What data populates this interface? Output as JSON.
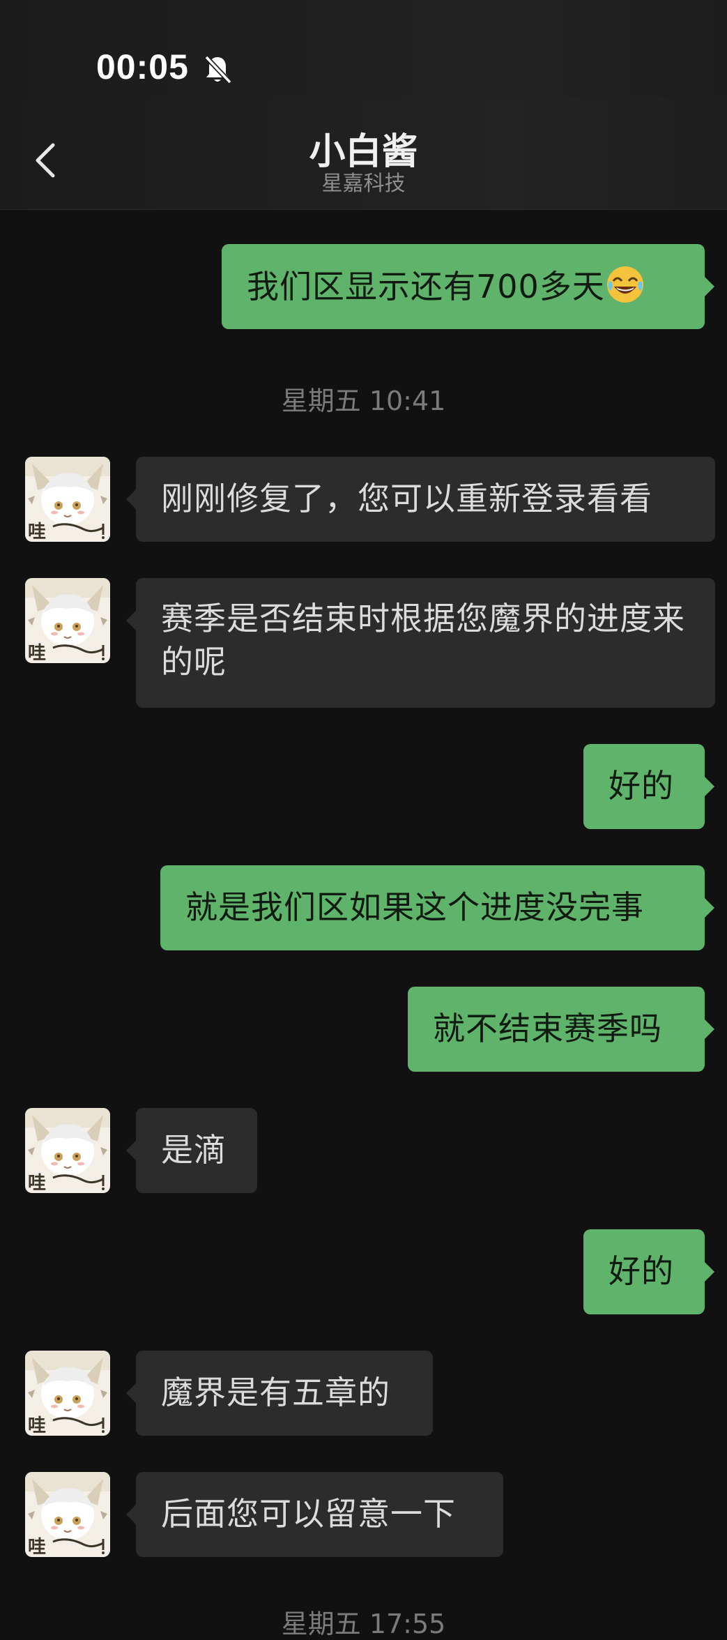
{
  "status_bar": {
    "time": "00:05",
    "mute_icon": "bell-slash-icon"
  },
  "header": {
    "back_icon": "chevron-left-icon",
    "title": "小白酱",
    "subtitle": "星嘉科技"
  },
  "messages": [
    {
      "side": "out",
      "text": "我们区显示还有700多天",
      "emoji": "tears-of-joy-emoji"
    },
    {
      "type": "timestamp",
      "text": "星期五 10:41"
    },
    {
      "side": "in",
      "text": "刚刚修复了，您可以重新登录看看"
    },
    {
      "side": "in",
      "text": "赛季是否结束时根据您魔界的进度来的呢"
    },
    {
      "side": "out",
      "text": "好的"
    },
    {
      "side": "out",
      "text": "就是我们区如果这个进度没完事"
    },
    {
      "side": "out",
      "text": "就不结束赛季吗"
    },
    {
      "side": "in",
      "text": "是滴"
    },
    {
      "side": "out",
      "text": "好的"
    },
    {
      "side": "in",
      "text": "魔界是有五章的"
    },
    {
      "side": "in",
      "text": "后面您可以留意一下"
    },
    {
      "type": "timestamp",
      "text": "星期五 17:55"
    }
  ],
  "colors": {
    "background": "#111111",
    "outgoing_bubble": "#5fb36a",
    "incoming_bubble": "#2c2c2c",
    "timestamp": "#7b7b7b"
  }
}
